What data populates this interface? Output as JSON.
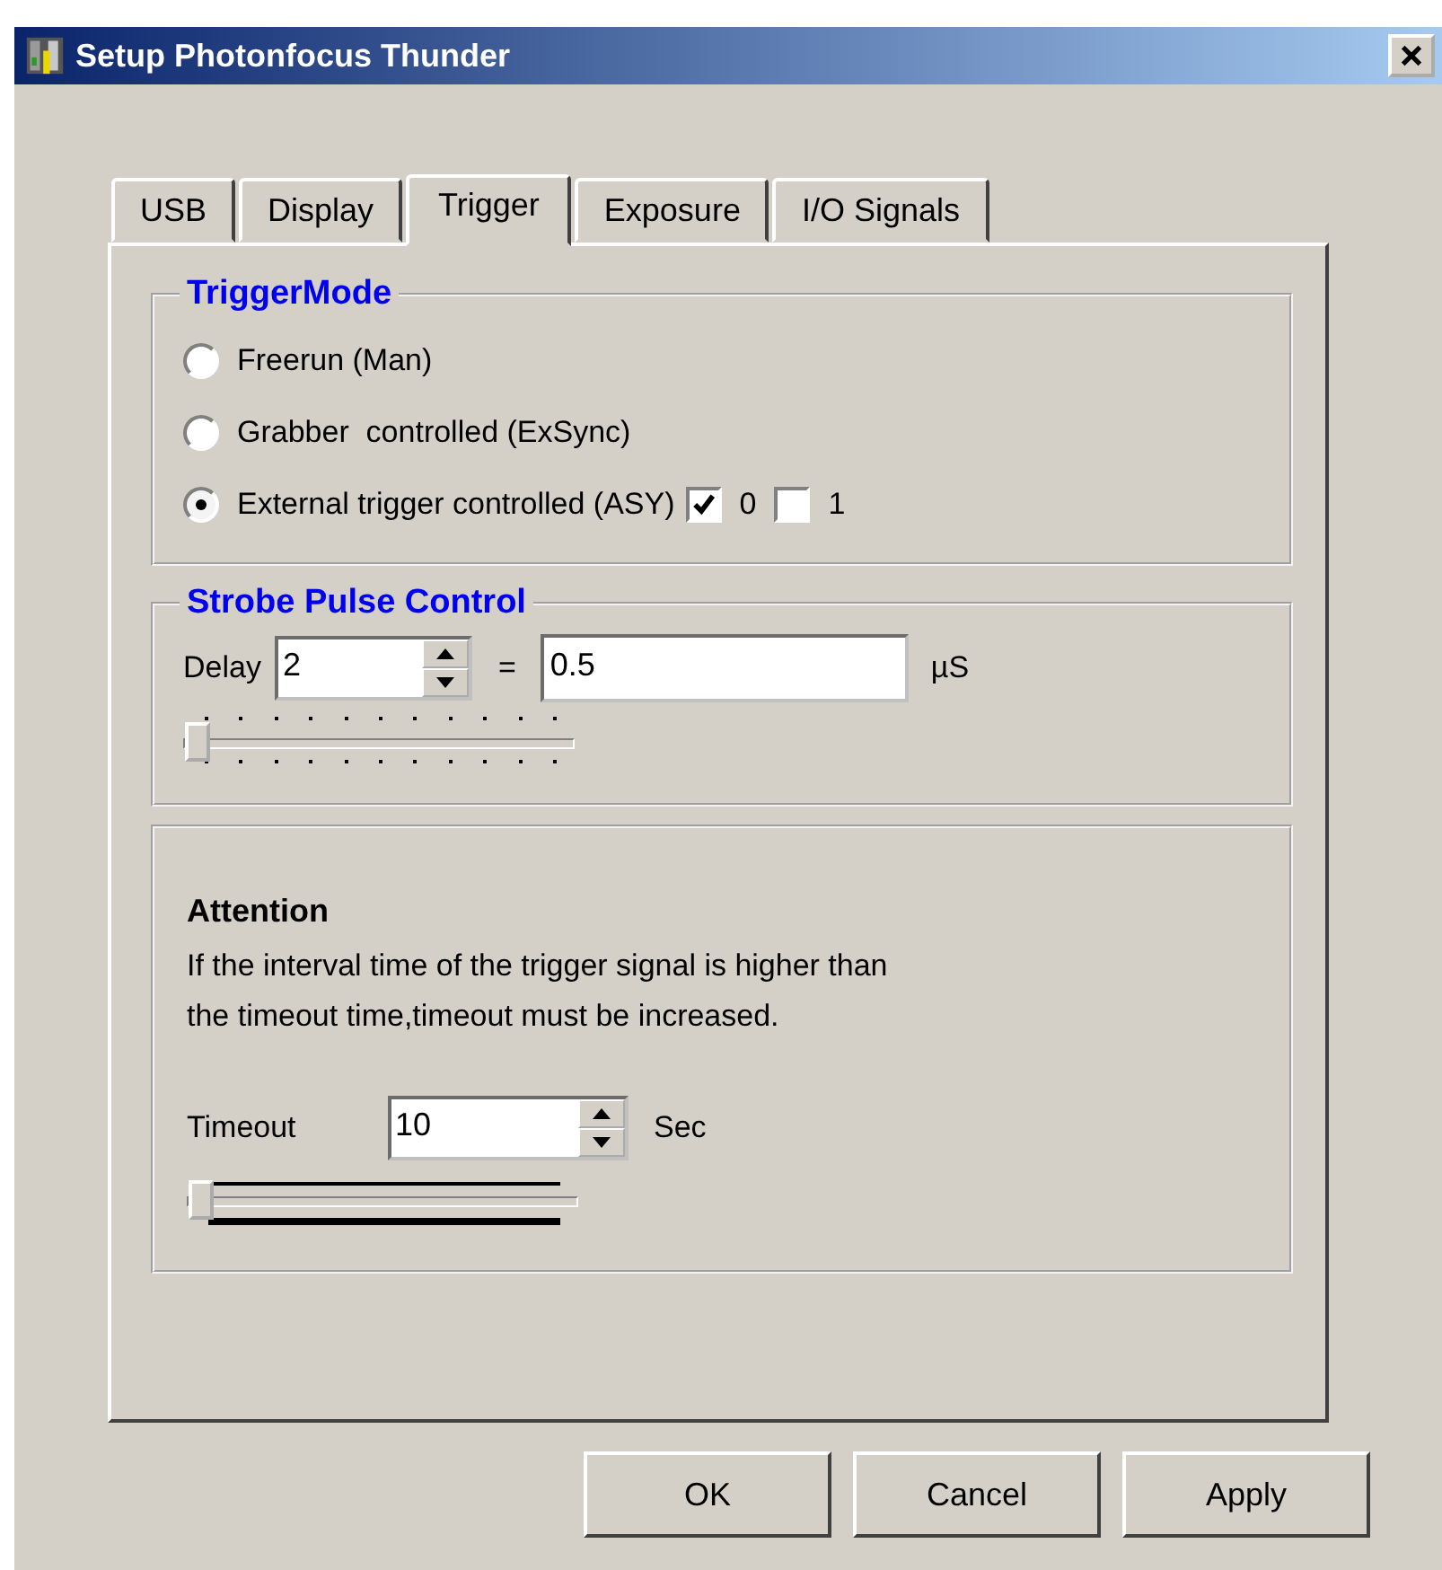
{
  "window": {
    "title": "Setup Photonfocus Thunder"
  },
  "tabs": [
    {
      "label": "USB",
      "selected": false
    },
    {
      "label": "Display",
      "selected": false
    },
    {
      "label": "Trigger",
      "selected": true
    },
    {
      "label": "Exposure",
      "selected": false
    },
    {
      "label": "I/O Signals",
      "selected": false
    }
  ],
  "trigger_mode": {
    "title": "TriggerMode",
    "options": [
      {
        "label": "Freerun (Man)",
        "selected": false
      },
      {
        "label": "Grabber  controlled (ExSync)",
        "selected": false
      },
      {
        "label": "External trigger controlled (ASY)",
        "selected": true
      }
    ],
    "channels": [
      {
        "label": "0",
        "checked": true
      },
      {
        "label": "1",
        "checked": false
      }
    ]
  },
  "strobe": {
    "title": "Strobe Pulse Control",
    "delay_label": "Delay",
    "delay_value": "2",
    "equals": "=",
    "result_value": "0.5",
    "unit": "µS",
    "slider": {
      "level": 0
    }
  },
  "attention": {
    "title": "Attention",
    "message": "If the interval time of the trigger signal is higher than\nthe timeout time,timeout must be increased.",
    "timeout_label": "Timeout",
    "timeout_value": "10",
    "unit": "Sec",
    "slider": {
      "level": 0
    }
  },
  "buttons": [
    "OK",
    "Cancel",
    "Apply"
  ]
}
